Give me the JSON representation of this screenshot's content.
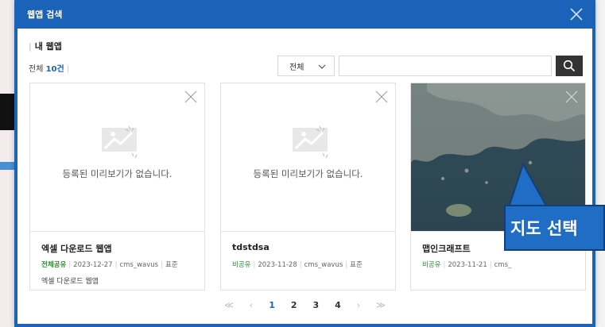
{
  "modal": {
    "title": "웹앱 검색",
    "close_icon": "close-icon"
  },
  "section": {
    "title": "내 웹앱"
  },
  "summary": {
    "total_label": "전체",
    "total_count": "10건"
  },
  "filter": {
    "selected": "전체"
  },
  "search": {
    "placeholder": "",
    "value": ""
  },
  "cards": [
    {
      "no_preview_text": "등록된 미리보기가 없습니다.",
      "title": "엑셀 다운로드 웹앱",
      "share": "전체공유",
      "date": "2023-12-27",
      "owner": "cms_wavus",
      "type": "표준",
      "description": "엑셀 다운로드 웹앱"
    },
    {
      "no_preview_text": "등록된 미리보기가 없습니다.",
      "title": "tdstdsa",
      "share": "비공유",
      "date": "2023-11-28",
      "owner": "cms_wavus",
      "type": "표준",
      "description": ""
    },
    {
      "title": "맵인크래프트",
      "share": "비공유",
      "date": "2023-11-21",
      "owner": "cms_",
      "description": ""
    }
  ],
  "pagination": {
    "first": "≪",
    "prev": "‹",
    "next": "›",
    "last": "≫",
    "pages": [
      "1",
      "2",
      "3",
      "4"
    ],
    "active": "1"
  },
  "callout": {
    "text": "지도 선택"
  },
  "colors": {
    "accent": "#1b63b8",
    "callout": "#1f6dc4",
    "share": "#2d8a2d"
  }
}
